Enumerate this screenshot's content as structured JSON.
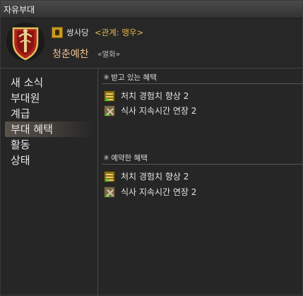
{
  "window": {
    "title": "자유부대"
  },
  "header": {
    "grade_name": "쌍사당",
    "relation": "<관계: 맹우>",
    "fc_name": "청춘예찬",
    "fc_tag": "«열화»"
  },
  "nav": {
    "items": [
      {
        "label": "새 소식"
      },
      {
        "label": "부대원"
      },
      {
        "label": "계급"
      },
      {
        "label": "부대 혜택"
      },
      {
        "label": "활동"
      },
      {
        "label": "상태"
      }
    ],
    "selected": "부대 혜택"
  },
  "benefits": {
    "active_title": "받고 있는 혜택",
    "active": [
      {
        "label": "처치 경험치 향상 2",
        "icon": "exp-bonus-icon"
      },
      {
        "label": "식사 지속시간 연장 2",
        "icon": "food-duration-icon"
      }
    ],
    "reserved_title": "예약한 혜택",
    "reserved": [
      {
        "label": "처치 경험치 향상 2",
        "icon": "exp-bonus-icon"
      },
      {
        "label": "식사 지속시간 연장 2",
        "icon": "food-duration-icon"
      }
    ]
  },
  "colors": {
    "relation": "#e8b84a",
    "fc_name": "#f0c090",
    "selected_bg": "#5a534b"
  }
}
